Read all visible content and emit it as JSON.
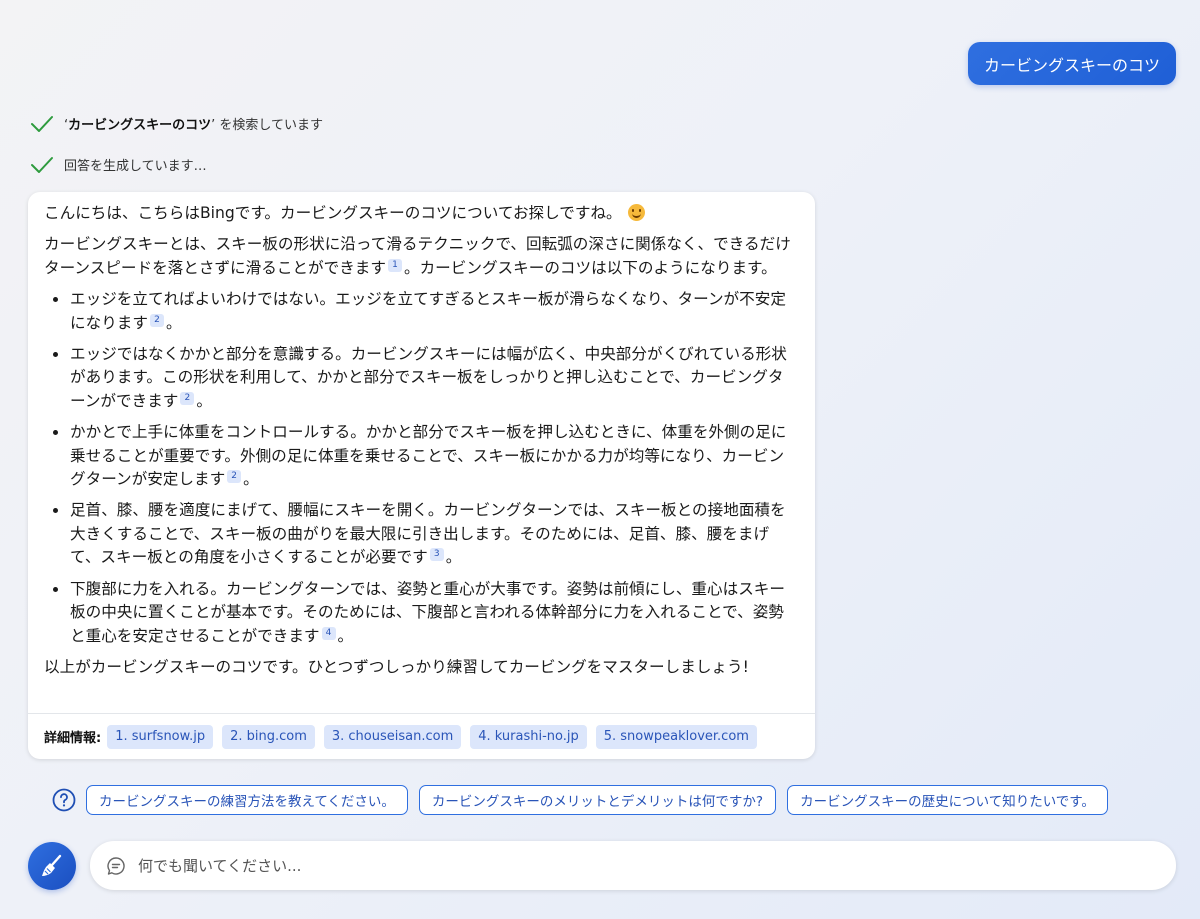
{
  "user_message": "カービングスキーのコツ",
  "status": {
    "searching_open_quote": "‘",
    "searching_query": "カービングスキーのコツ",
    "searching_close_quote": "’",
    "searching_suffix": " を検索しています",
    "generating": "回答を生成しています…"
  },
  "answer": {
    "greeting": "こんにちは、こちらはBingです。カービングスキーのコツについてお探しですね。",
    "intro_text": "カービングスキーとは、スキー板の形状に沿って滑るテクニックで、回転弧の深さに関係なく、できるだけターンスピードを落とさずに滑ることができます",
    "intro_cite": "1",
    "intro_tail": "。カービングスキーのコツは以下のようになります。",
    "bullets": [
      {
        "text": "エッジを立てればよいわけではない。エッジを立てすぎるとスキー板が滑らなくなり、ターンが不安定になります",
        "cite": "2",
        "tail": "。"
      },
      {
        "text": "エッジではなくかかと部分を意識する。カービングスキーには幅が広く、中央部分がくびれている形状があります。この形状を利用して、かかと部分でスキー板をしっかりと押し込むことで、カービングターンができます",
        "cite": "2",
        "tail": "。"
      },
      {
        "text": "かかとで上手に体重をコントロールする。かかと部分でスキー板を押し込むときに、体重を外側の足に乗せることが重要です。外側の足に体重を乗せることで、スキー板にかかる力が均等になり、カービングターンが安定します",
        "cite": "2",
        "tail": "。"
      },
      {
        "text": "足首、膝、腰を適度にまげて、腰幅にスキーを開く。カービングターンでは、スキー板との接地面積を大きくすることで、スキー板の曲がりを最大限に引き出します。そのためには、足首、膝、腰をまげて、スキー板との角度を小さくすることが必要です",
        "cite": "3",
        "tail": "。"
      },
      {
        "text": "下腹部に力を入れる。カービングターンでは、姿勢と重心が大事です。姿勢は前傾にし、重心はスキー板の中央に置くことが基本です。そのためには、下腹部と言われる体幹部分に力を入れることで、姿勢と重心を安定させることができます",
        "cite": "4",
        "tail": "。"
      }
    ],
    "closing": "以上がカービングスキーのコツです。ひとつずつしっかり練習してカービングをマスターしましょう!",
    "details_label": "詳細情報:",
    "sources": [
      "1. surfsnow.jp",
      "2. bing.com",
      "3. chouseisan.com",
      "4. kurashi-no.jp",
      "5. snowpeaklover.com"
    ]
  },
  "suggestions": [
    "カービングスキーの練習方法を教えてください。",
    "カービングスキーのメリットとデメリットは何ですか?",
    "カービングスキーの歴史について知りたいです。"
  ],
  "input": {
    "placeholder": "何でも聞いてください..."
  },
  "icons": {
    "check": "check-icon",
    "emoji": "smiling-face-icon",
    "question": "question-circle-icon",
    "broom": "broom-icon",
    "chat": "chat-bubble-icon"
  },
  "colors": {
    "accent": "#2f6fe0",
    "check_green": "#2e9b3e",
    "chip_bg": "#dce6fb",
    "chip_text": "#2a55b8"
  }
}
